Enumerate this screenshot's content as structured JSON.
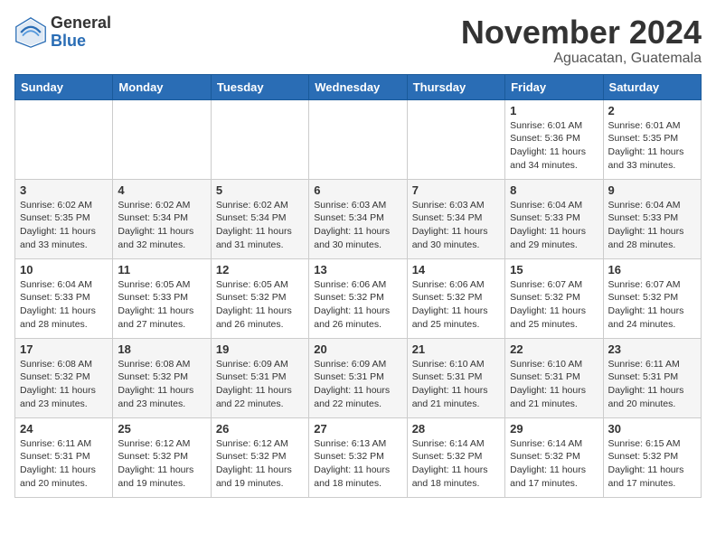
{
  "header": {
    "logo_line1": "General",
    "logo_line2": "Blue",
    "month": "November 2024",
    "location": "Aguacatan, Guatemala"
  },
  "weekdays": [
    "Sunday",
    "Monday",
    "Tuesday",
    "Wednesday",
    "Thursday",
    "Friday",
    "Saturday"
  ],
  "weeks": [
    [
      {
        "day": "",
        "info": ""
      },
      {
        "day": "",
        "info": ""
      },
      {
        "day": "",
        "info": ""
      },
      {
        "day": "",
        "info": ""
      },
      {
        "day": "",
        "info": ""
      },
      {
        "day": "1",
        "info": "Sunrise: 6:01 AM\nSunset: 5:36 PM\nDaylight: 11 hours and 34 minutes."
      },
      {
        "day": "2",
        "info": "Sunrise: 6:01 AM\nSunset: 5:35 PM\nDaylight: 11 hours and 33 minutes."
      }
    ],
    [
      {
        "day": "3",
        "info": "Sunrise: 6:02 AM\nSunset: 5:35 PM\nDaylight: 11 hours and 33 minutes."
      },
      {
        "day": "4",
        "info": "Sunrise: 6:02 AM\nSunset: 5:34 PM\nDaylight: 11 hours and 32 minutes."
      },
      {
        "day": "5",
        "info": "Sunrise: 6:02 AM\nSunset: 5:34 PM\nDaylight: 11 hours and 31 minutes."
      },
      {
        "day": "6",
        "info": "Sunrise: 6:03 AM\nSunset: 5:34 PM\nDaylight: 11 hours and 30 minutes."
      },
      {
        "day": "7",
        "info": "Sunrise: 6:03 AM\nSunset: 5:34 PM\nDaylight: 11 hours and 30 minutes."
      },
      {
        "day": "8",
        "info": "Sunrise: 6:04 AM\nSunset: 5:33 PM\nDaylight: 11 hours and 29 minutes."
      },
      {
        "day": "9",
        "info": "Sunrise: 6:04 AM\nSunset: 5:33 PM\nDaylight: 11 hours and 28 minutes."
      }
    ],
    [
      {
        "day": "10",
        "info": "Sunrise: 6:04 AM\nSunset: 5:33 PM\nDaylight: 11 hours and 28 minutes."
      },
      {
        "day": "11",
        "info": "Sunrise: 6:05 AM\nSunset: 5:33 PM\nDaylight: 11 hours and 27 minutes."
      },
      {
        "day": "12",
        "info": "Sunrise: 6:05 AM\nSunset: 5:32 PM\nDaylight: 11 hours and 26 minutes."
      },
      {
        "day": "13",
        "info": "Sunrise: 6:06 AM\nSunset: 5:32 PM\nDaylight: 11 hours and 26 minutes."
      },
      {
        "day": "14",
        "info": "Sunrise: 6:06 AM\nSunset: 5:32 PM\nDaylight: 11 hours and 25 minutes."
      },
      {
        "day": "15",
        "info": "Sunrise: 6:07 AM\nSunset: 5:32 PM\nDaylight: 11 hours and 25 minutes."
      },
      {
        "day": "16",
        "info": "Sunrise: 6:07 AM\nSunset: 5:32 PM\nDaylight: 11 hours and 24 minutes."
      }
    ],
    [
      {
        "day": "17",
        "info": "Sunrise: 6:08 AM\nSunset: 5:32 PM\nDaylight: 11 hours and 23 minutes."
      },
      {
        "day": "18",
        "info": "Sunrise: 6:08 AM\nSunset: 5:32 PM\nDaylight: 11 hours and 23 minutes."
      },
      {
        "day": "19",
        "info": "Sunrise: 6:09 AM\nSunset: 5:31 PM\nDaylight: 11 hours and 22 minutes."
      },
      {
        "day": "20",
        "info": "Sunrise: 6:09 AM\nSunset: 5:31 PM\nDaylight: 11 hours and 22 minutes."
      },
      {
        "day": "21",
        "info": "Sunrise: 6:10 AM\nSunset: 5:31 PM\nDaylight: 11 hours and 21 minutes."
      },
      {
        "day": "22",
        "info": "Sunrise: 6:10 AM\nSunset: 5:31 PM\nDaylight: 11 hours and 21 minutes."
      },
      {
        "day": "23",
        "info": "Sunrise: 6:11 AM\nSunset: 5:31 PM\nDaylight: 11 hours and 20 minutes."
      }
    ],
    [
      {
        "day": "24",
        "info": "Sunrise: 6:11 AM\nSunset: 5:31 PM\nDaylight: 11 hours and 20 minutes."
      },
      {
        "day": "25",
        "info": "Sunrise: 6:12 AM\nSunset: 5:32 PM\nDaylight: 11 hours and 19 minutes."
      },
      {
        "day": "26",
        "info": "Sunrise: 6:12 AM\nSunset: 5:32 PM\nDaylight: 11 hours and 19 minutes."
      },
      {
        "day": "27",
        "info": "Sunrise: 6:13 AM\nSunset: 5:32 PM\nDaylight: 11 hours and 18 minutes."
      },
      {
        "day": "28",
        "info": "Sunrise: 6:14 AM\nSunset: 5:32 PM\nDaylight: 11 hours and 18 minutes."
      },
      {
        "day": "29",
        "info": "Sunrise: 6:14 AM\nSunset: 5:32 PM\nDaylight: 11 hours and 17 minutes."
      },
      {
        "day": "30",
        "info": "Sunrise: 6:15 AM\nSunset: 5:32 PM\nDaylight: 11 hours and 17 minutes."
      }
    ]
  ]
}
